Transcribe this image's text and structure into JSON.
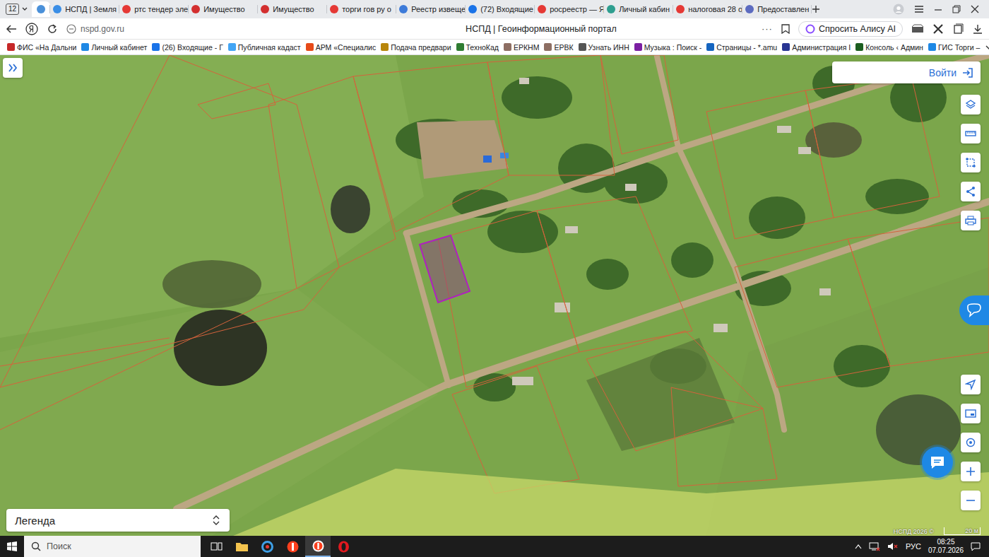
{
  "browser": {
    "tab_count": "12",
    "tabs": [
      {
        "label": "",
        "kind": "pinned",
        "selected": true,
        "color": "#4a90d9"
      },
      {
        "label": "НСПД | Земля",
        "kind": "normal",
        "selected": false,
        "color": "#3a8ee6"
      },
      {
        "label": "ртс тендер эле",
        "kind": "normal",
        "selected": false,
        "color": "#e53935"
      },
      {
        "label": "Имущество",
        "kind": "normal",
        "selected": false,
        "color": "#d32f2f"
      },
      {
        "label": "Имущество",
        "kind": "normal",
        "selected": false,
        "color": "#d32f2f"
      },
      {
        "label": "торги гов ру о",
        "kind": "normal",
        "selected": false,
        "color": "#e53935"
      },
      {
        "label": "Реестр извеще",
        "kind": "normal",
        "selected": false,
        "color": "#3d7bd9"
      },
      {
        "label": "(72) Входящие",
        "kind": "normal",
        "selected": false,
        "color": "#1a73e8"
      },
      {
        "label": "росреестр — Я",
        "kind": "normal",
        "selected": false,
        "color": "#e53935"
      },
      {
        "label": "Личный кабин",
        "kind": "normal",
        "selected": false,
        "color": "#2e9e8f"
      },
      {
        "label": "налоговая 28 о",
        "kind": "normal",
        "selected": false,
        "color": "#e53935"
      },
      {
        "label": "Предоставлен",
        "kind": "normal",
        "selected": false,
        "color": "#5c6bc0"
      }
    ],
    "address": "nspd.gov.ru",
    "page_title": "НСПД | Геоинформационный портал",
    "more": "···",
    "alice": "Спросить Алису AI"
  },
  "bookmarks": [
    {
      "label": "ФИС «На Дальни",
      "color": "#c62828"
    },
    {
      "label": "Личный кабинет",
      "color": "#1e88e5"
    },
    {
      "label": "(26) Входящие - Г",
      "color": "#1a73e8"
    },
    {
      "label": "Публичная кадаст",
      "color": "#42a5f5"
    },
    {
      "label": "АРМ «Специалис",
      "color": "#e64a19"
    },
    {
      "label": "Подача предвари",
      "color": "#b8860b"
    },
    {
      "label": "ТехноКад",
      "color": "#2e7d32"
    },
    {
      "label": "ЕРКНМ",
      "color": "#8d6e63"
    },
    {
      "label": "ЕРВК",
      "color": "#8d6e63"
    },
    {
      "label": "Узнать ИНН",
      "color": "#555555"
    },
    {
      "label": "Музыка : Поиск - ",
      "color": "#7b1fa2"
    },
    {
      "label": "Страницы - *.amu",
      "color": "#1565c0"
    },
    {
      "label": "Администрация I",
      "color": "#283593"
    },
    {
      "label": "Консоль ‹ Админ",
      "color": "#1b5e20"
    },
    {
      "label": "ГИС Торги –",
      "color": "#1e88e5"
    }
  ],
  "map": {
    "login": "Войти",
    "legend": "Легенда",
    "attribution": "НСПД 2026 ©",
    "scale": "20 м"
  },
  "taskbar": {
    "search": "Поиск",
    "apps": [
      {
        "kind": "taskview",
        "selected": false
      },
      {
        "kind": "folder",
        "selected": false
      },
      {
        "kind": "circle",
        "selected": false
      },
      {
        "kind": "yandex",
        "selected": false
      },
      {
        "kind": "ybrowser",
        "selected": true
      },
      {
        "kind": "opera",
        "selected": false
      }
    ],
    "lang": "РУС",
    "time": "08:25",
    "date": "07.07.2026"
  }
}
